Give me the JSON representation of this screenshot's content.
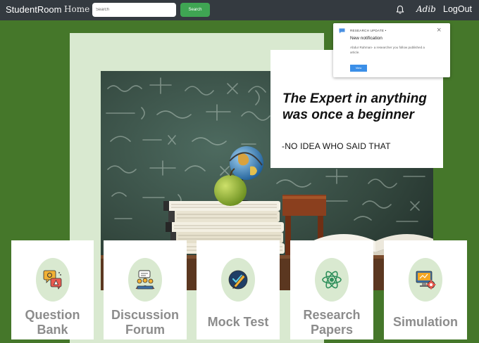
{
  "navbar": {
    "brand": "StudentRoom",
    "home_label": "Home",
    "search_placeholder": "Search",
    "search_button": "Search",
    "bell_icon": "bell-icon",
    "user_name": "Adib",
    "logout_label": "LogOut"
  },
  "notification": {
    "category": "RESEARCH UPDATE  •",
    "title": "New notification",
    "body": "Abdur Rahman- a researcher you follow published a article.",
    "button": "View",
    "icon": "chat-icon"
  },
  "hero": {
    "quote": "The Expert in anything was once a beginner",
    "author": "-NO IDEA WHO SAID THAT"
  },
  "cards": [
    {
      "label": "Question Bank",
      "icon": "question-chat-icon"
    },
    {
      "label": "Discussion Forum",
      "icon": "discussion-icon"
    },
    {
      "label": "Mock Test",
      "icon": "pencil-test-icon"
    },
    {
      "label": "Research Papers",
      "icon": "atom-icon"
    },
    {
      "label": "Simulation",
      "icon": "monitor-gear-icon"
    }
  ],
  "colors": {
    "background": "#45772a",
    "navbar": "#343a40",
    "search_button": "#3fa553",
    "frame": "#d9e9d0",
    "card_label": "#8c8c8c"
  }
}
